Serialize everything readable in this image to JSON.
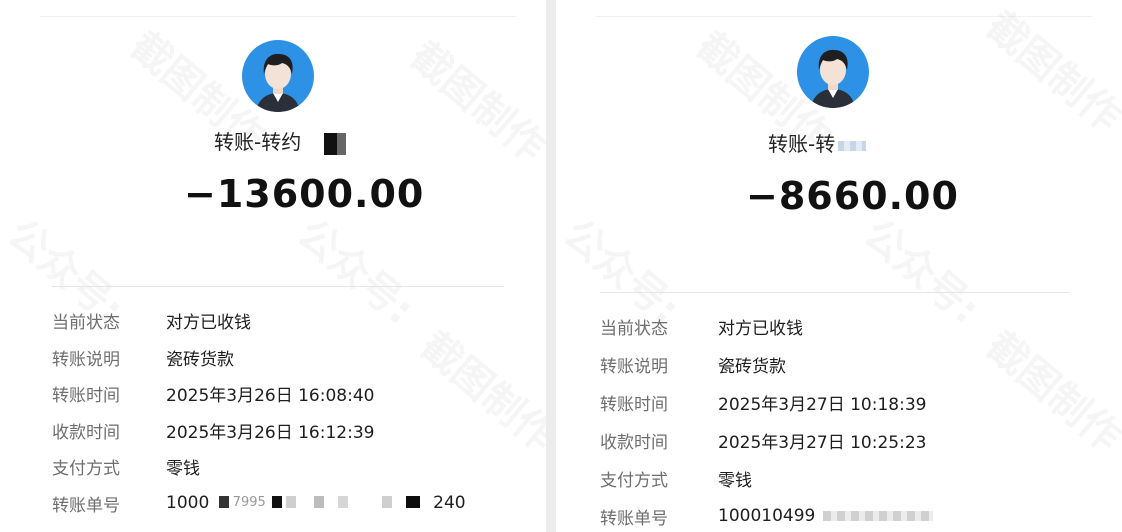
{
  "watermarks": [
    "截图制作",
    "公众号:"
  ],
  "left": {
    "name": "转账-转约",
    "amount": "−13600.00",
    "rows": [
      {
        "label": "当前状态",
        "value": "对方已收钱"
      },
      {
        "label": "转账说明",
        "value": "瓷砖货款"
      },
      {
        "label": "转账时间",
        "value": "2025年3月26日 16:08:40"
      },
      {
        "label": "收款时间",
        "value": "2025年3月26日 16:12:39"
      },
      {
        "label": "支付方式",
        "value": "零钱"
      },
      {
        "label": "转账单号",
        "value_prefix": "1000",
        "value_mid": "7995",
        "value_suffix": "240"
      }
    ]
  },
  "right": {
    "name": "转账-转",
    "amount": "−8660.00",
    "rows": [
      {
        "label": "当前状态",
        "value": "对方已收钱"
      },
      {
        "label": "转账说明",
        "value": "瓷砖货款"
      },
      {
        "label": "转账时间",
        "value": "2025年3月27日 10:18:39"
      },
      {
        "label": "收款时间",
        "value": "2025年3月27日 10:25:23"
      },
      {
        "label": "支付方式",
        "value": "零钱"
      },
      {
        "label": "转账单号",
        "value_prefix": "100010499"
      }
    ]
  },
  "colors": {
    "avatar_bg": "#2d92e6",
    "label": "#6e6e6e",
    "value": "#1e1e1e"
  }
}
